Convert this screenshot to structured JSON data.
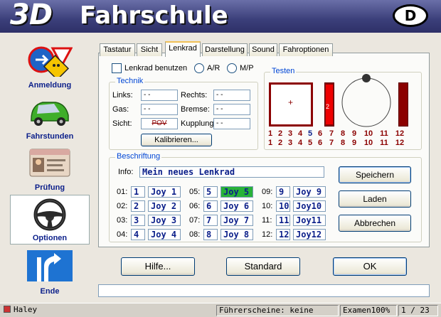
{
  "header": {
    "logo_3d": "3D",
    "logo_text": "Fahrschule",
    "country_badge": "D"
  },
  "sidebar": {
    "items": [
      {
        "label": "Anmeldung",
        "icon": "traffic-signs-icon"
      },
      {
        "label": "Fahrstunden",
        "icon": "car-icon"
      },
      {
        "label": "Prüfung",
        "icon": "license-card-icon"
      },
      {
        "label": "Optionen",
        "icon": "steering-wheel-icon",
        "active": true
      },
      {
        "label": "Ende",
        "icon": "exit-sign-icon"
      }
    ]
  },
  "tabs": [
    {
      "label": "Tastatur"
    },
    {
      "label": "Sicht"
    },
    {
      "label": "Lenkrad",
      "active": true
    },
    {
      "label": "Darstellung"
    },
    {
      "label": "Sound"
    },
    {
      "label": "Fahroptionen"
    }
  ],
  "lenkrad": {
    "use_label": "Lenkrad benutzen",
    "use_checked": false,
    "mode_ar": "A/R",
    "mode_mp": "M/P",
    "technik": {
      "title": "Technik",
      "links_label": "Links:",
      "links_value": "- -",
      "rechts_label": "Rechts:",
      "rechts_value": "- -",
      "gas_label": "Gas:",
      "gas_value": "- -",
      "bremse_label": "Bremse:",
      "bremse_value": "- -",
      "sicht_label": "Sicht:",
      "sicht_value": "POV",
      "kupplung_label": "Kupplung:",
      "kupplung_value": "- -",
      "calibrate_label": "Kalibrieren..."
    },
    "testen": {
      "title": "Testen",
      "bar2_label": "2",
      "row1": [
        "1",
        "2",
        "3",
        "4",
        "5",
        "6",
        "7",
        "8",
        "9",
        "10",
        "11",
        "12"
      ],
      "row2": [
        "1",
        "2",
        "3",
        "4",
        "5",
        "6",
        "7",
        "8",
        "9",
        "10",
        "11",
        "12"
      ],
      "active_button": "5"
    },
    "beschriftung": {
      "title": "Beschriftung",
      "info_label": "Info:",
      "info_value": "Mein neues Lenkrad",
      "save_label": "Speichern",
      "load_label": "Laden",
      "cancel_label": "Abbrechen",
      "joys": [
        {
          "label": "01:",
          "num": "1",
          "name": "Joy 1"
        },
        {
          "label": "02:",
          "num": "2",
          "name": "Joy 2"
        },
        {
          "label": "03:",
          "num": "3",
          "name": "Joy 3"
        },
        {
          "label": "04:",
          "num": "4",
          "name": "Joy 4"
        },
        {
          "label": "05:",
          "num": "5",
          "name": "Joy 5",
          "highlight": true
        },
        {
          "label": "06:",
          "num": "6",
          "name": "Joy 6"
        },
        {
          "label": "07:",
          "num": "7",
          "name": "Joy 7"
        },
        {
          "label": "08:",
          "num": "8",
          "name": "Joy 8"
        },
        {
          "label": "09:",
          "num": "9",
          "name": "Joy 9"
        },
        {
          "label": "10:",
          "num": "10",
          "name": "Joy10"
        },
        {
          "label": "11:",
          "num": "11",
          "name": "Joy11"
        },
        {
          "label": "12:",
          "num": "12",
          "name": "Joy12"
        }
      ]
    }
  },
  "buttons": {
    "help": "Hilfe...",
    "standard": "Standard",
    "ok": "OK"
  },
  "status": {
    "user": "Haley",
    "licenses": "Führerscheine: keine",
    "exam": "Examen100%",
    "page": "1 / 23"
  },
  "colors": {
    "header": "#3b3f7a",
    "accent_blue": "#0b1f8a",
    "highlight_green": "#29b239",
    "test_red": "#8b0000"
  }
}
